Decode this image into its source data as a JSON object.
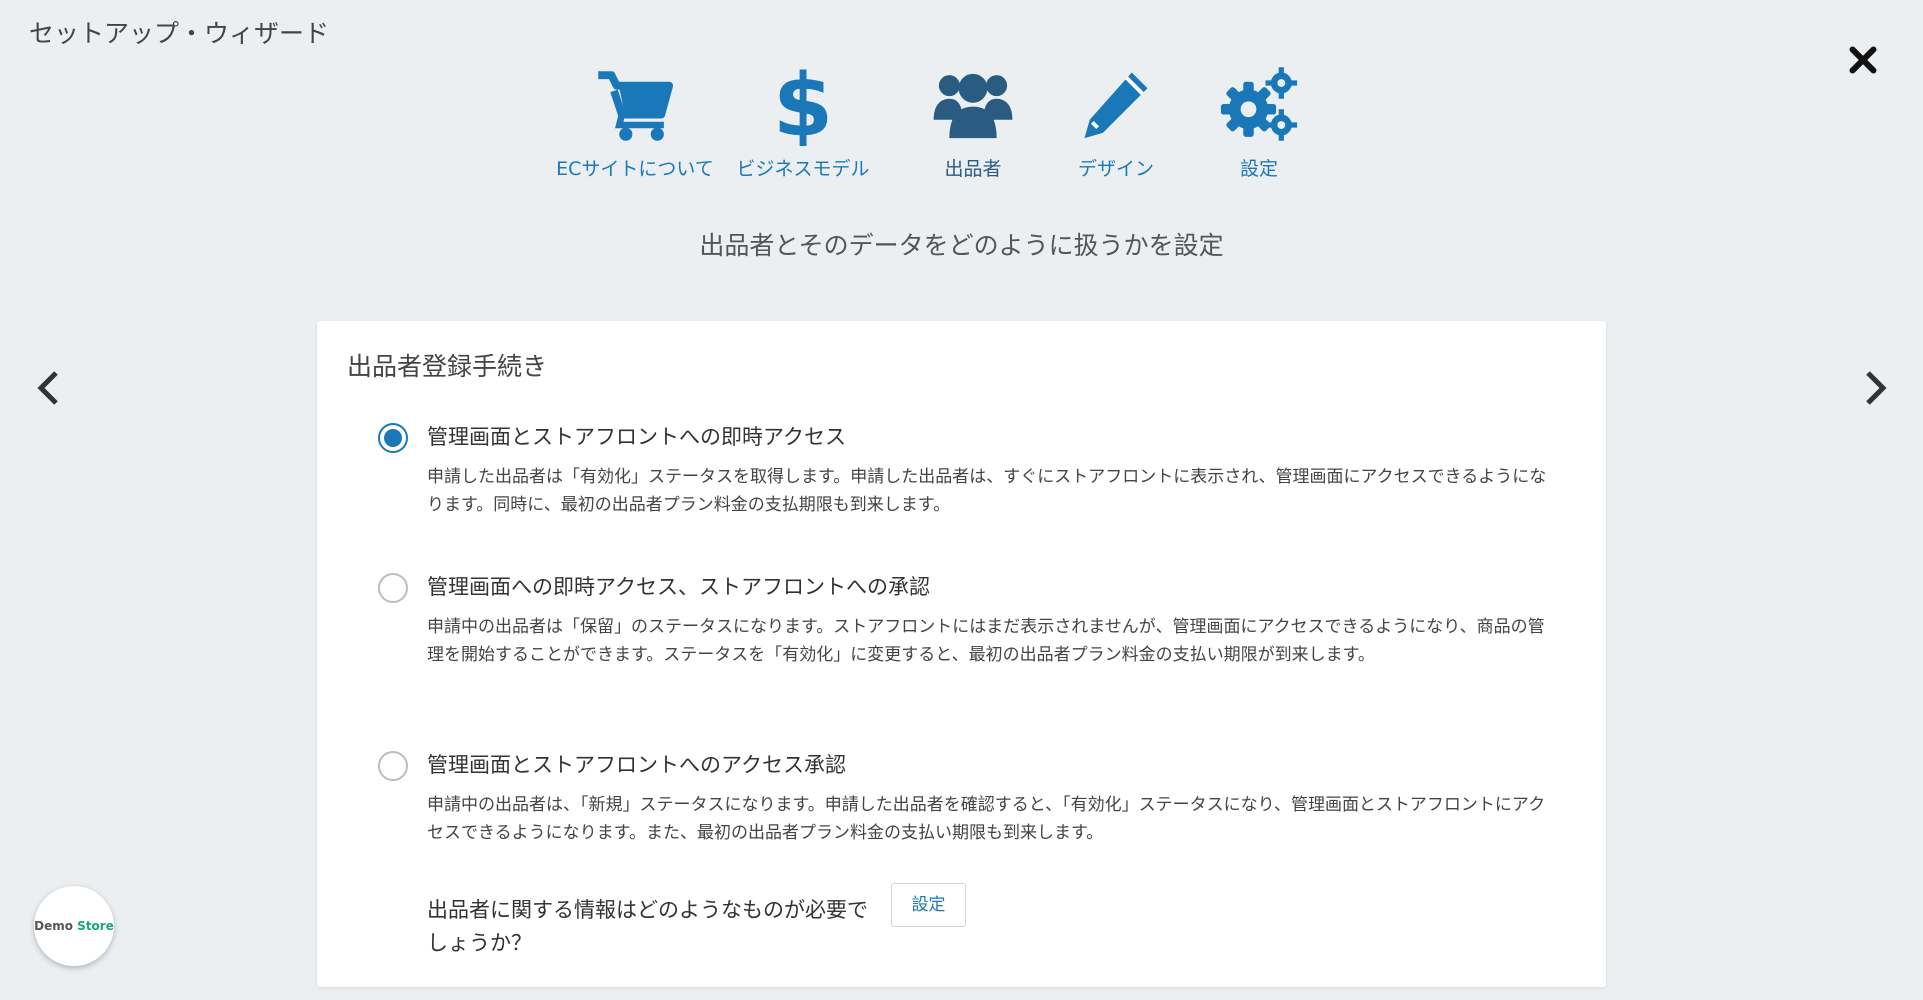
{
  "window": {
    "title": "セットアップ・ウィザード"
  },
  "steps": [
    {
      "label": "ECサイトについて",
      "icon": "cart-icon"
    },
    {
      "label": "ビジネスモデル",
      "icon": "dollar-icon"
    },
    {
      "label": "出品者",
      "icon": "users-icon"
    },
    {
      "label": "デザイン",
      "icon": "pencil-icon"
    },
    {
      "label": "設定",
      "icon": "gears-icon"
    }
  ],
  "subtitle": "出品者とそのデータをどのように扱うかを設定",
  "panel": {
    "title": "出品者登録手続き",
    "options": [
      {
        "title": "管理画面とストアフロントへの即時アクセス",
        "desc": "申請した出品者は「有効化」ステータスを取得します。申請した出品者は、すぐにストアフロントに表示され、管理画面にアクセスできるようになります。同時に、最初の出品者プラン料金の支払期限も到来します。",
        "selected": true
      },
      {
        "title": "管理画面への即時アクセス、ストアフロントへの承認",
        "desc": "申請中の出品者は「保留」のステータスになります。ストアフロントにはまだ表示されませんが、管理画面にアクセスできるようになり、商品の管理を開始することができます。ステータスを「有効化」に変更すると、最初の出品者プラン料金の支払い期限が到来します。",
        "selected": false
      },
      {
        "title": "管理画面とストアフロントへのアクセス承認",
        "desc": "申請中の出品者は、「新規」ステータスになります。申請した出品者を確認すると、「有効化」ステータスになり、管理画面とストアフロントにアクセスできるようになります。また、最初の出品者プラン料金の支払い期限も到来します。",
        "selected": false
      }
    ],
    "info_text": "出品者に関する情報はどのようなものが必要でしょうか？",
    "settings_button": "設定"
  },
  "demo_badge": {
    "word1": "Demo",
    "word2": "Store"
  },
  "colors": {
    "accent": "#1a78b9",
    "background": "#eceff2",
    "demo_green": "#18a878"
  }
}
